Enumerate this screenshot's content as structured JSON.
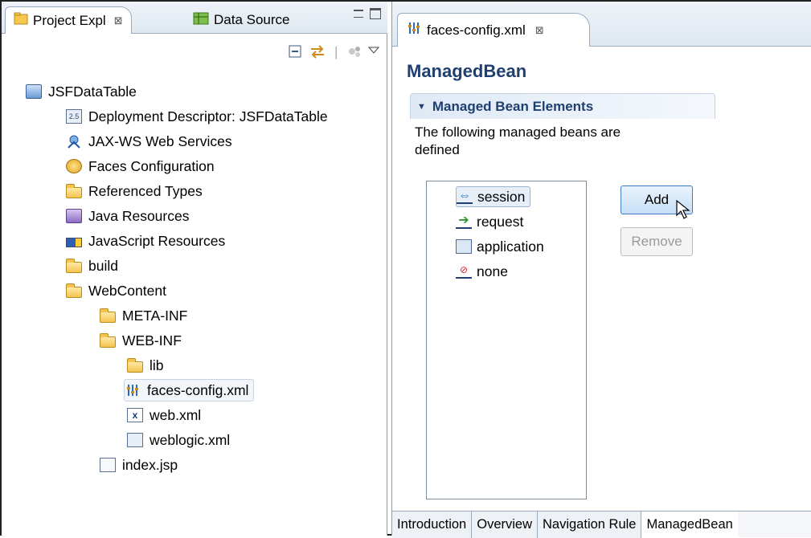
{
  "left_panel": {
    "tabs": [
      {
        "label": "Project Expl",
        "active": true,
        "close": "⊠"
      },
      {
        "label": "Data Source",
        "active": false
      }
    ],
    "tree": [
      {
        "label": "JSFDataTable",
        "icon": "project-icon"
      },
      {
        "label": "Deployment Descriptor: JSFDataTable",
        "icon": "deployment-descriptor-icon"
      },
      {
        "label": "JAX-WS Web Services",
        "icon": "web-services-icon"
      },
      {
        "label": "Faces Configuration",
        "icon": "faces-config-icon"
      },
      {
        "label": "Referenced Types",
        "icon": "folder-icon"
      },
      {
        "label": "Java Resources",
        "icon": "java-resources-icon"
      },
      {
        "label": "JavaScript Resources",
        "icon": "javascript-resources-icon"
      },
      {
        "label": "build",
        "icon": "folder-icon"
      },
      {
        "label": "WebContent",
        "icon": "folder-icon"
      },
      {
        "label": "META-INF",
        "icon": "folder-icon"
      },
      {
        "label": "WEB-INF",
        "icon": "folder-icon"
      },
      {
        "label": "lib",
        "icon": "folder-icon"
      },
      {
        "label": "faces-config.xml",
        "icon": "faces-config-file-icon",
        "selected": true
      },
      {
        "label": "web.xml",
        "icon": "xml-file-icon"
      },
      {
        "label": "weblogic.xml",
        "icon": "weblogic-file-icon"
      },
      {
        "label": "index.jsp",
        "icon": "jsp-file-icon"
      }
    ]
  },
  "editor": {
    "tab_label": "faces-config.xml",
    "tab_close": "⊠",
    "heading": "ManagedBean",
    "section_title": "Managed Bean Elements",
    "section_desc": "The following managed beans are defined",
    "scopes": [
      {
        "label": "session",
        "icon": "session-icon",
        "selected": true
      },
      {
        "label": "request",
        "icon": "request-icon"
      },
      {
        "label": "application",
        "icon": "application-icon"
      },
      {
        "label": "none",
        "icon": "none-icon"
      }
    ],
    "buttons": {
      "add": "Add",
      "remove": "Remove"
    },
    "bottom_tabs": [
      "Introduction",
      "Overview",
      "Navigation Rule",
      "ManagedBean"
    ],
    "active_bottom_tab": "ManagedBean"
  }
}
